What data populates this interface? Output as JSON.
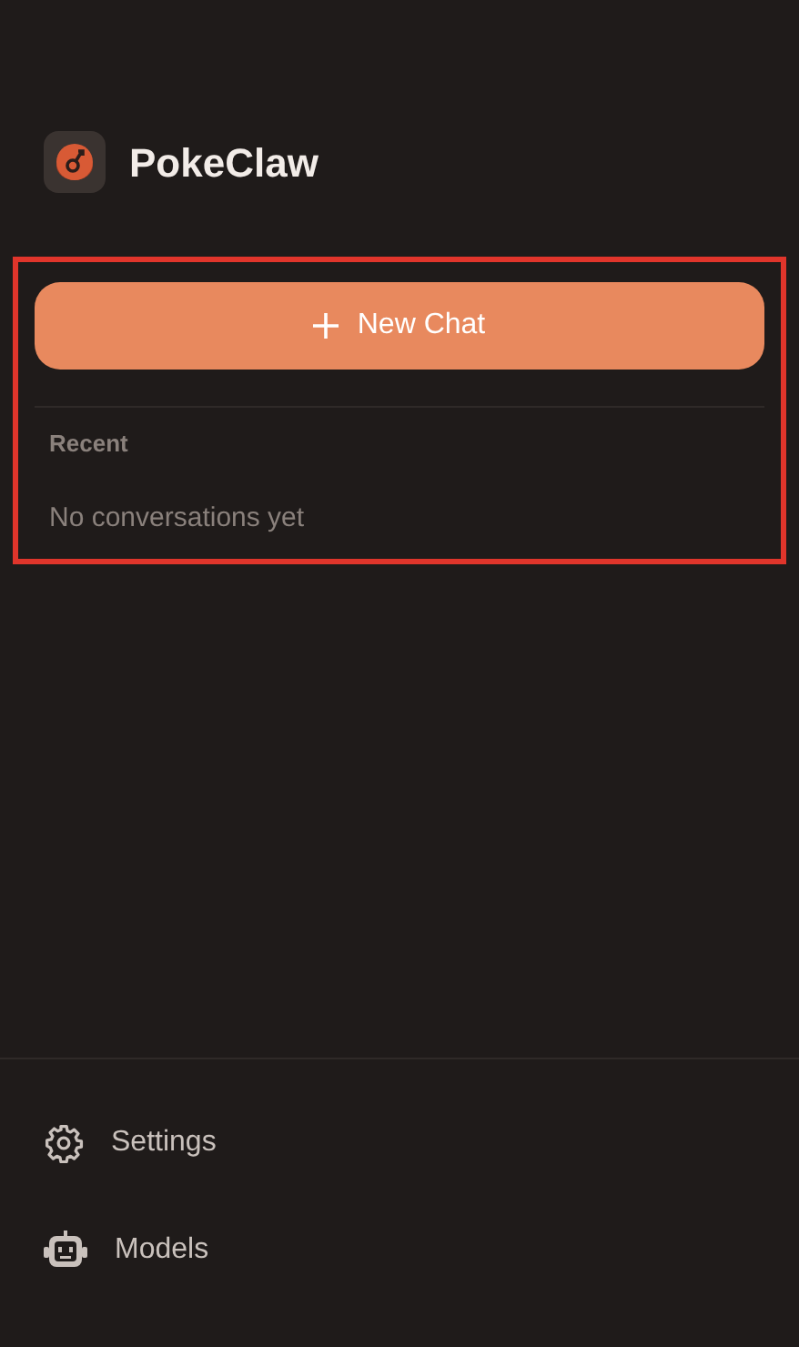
{
  "app": {
    "title": "PokeClaw"
  },
  "main_section": {
    "highlighted": true,
    "new_chat_button": {
      "label": "New Chat"
    },
    "recent": {
      "heading": "Recent",
      "empty_message": "No conversations yet"
    }
  },
  "footer_menu": [
    {
      "kind": "settings",
      "label": "Settings"
    },
    {
      "kind": "models",
      "label": "Models"
    }
  ]
}
